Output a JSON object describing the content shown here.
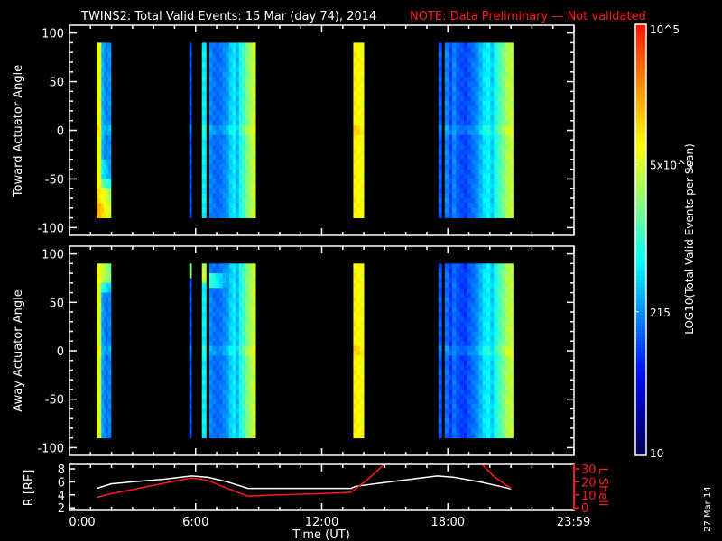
{
  "title": {
    "main": "TWINS2: Total Valid Events: 15 Mar (day  74), 2014",
    "note": "NOTE: Data Preliminary — Not validated",
    "note_color": "#ff1a1a"
  },
  "stamp": "27 Mar 14",
  "chart_data": {
    "type": "heatmap",
    "x_label": "Time (UT)",
    "x_range_hours": [
      0,
      24
    ],
    "x_tick_labels": [
      {
        "h": 0,
        "label": "0:00"
      },
      {
        "h": 6,
        "label": "6:00"
      },
      {
        "h": 12,
        "label": "12:00"
      },
      {
        "h": 18,
        "label": "18:00"
      },
      {
        "h": 23.98,
        "label": "23:59"
      }
    ],
    "colorbar": {
      "label": "LOG10(Total Valid Events per Scan)",
      "log_range": [
        1,
        5
      ],
      "tick_labels": [
        {
          "v": 5,
          "label": "10^5"
        },
        {
          "v": 3.699,
          "label": "5x10^3"
        },
        {
          "v": 2.332,
          "label": "215"
        },
        {
          "v": 1,
          "label": "10"
        }
      ]
    },
    "panels": [
      {
        "id": "toward",
        "ylabel": "Toward Actuator Angle",
        "y_range": [
          -108,
          108
        ],
        "y_tick_labels": [
          {
            "v": 100,
            "label": "100"
          },
          {
            "v": 50,
            "label": "50"
          },
          {
            "v": 0,
            "label": "0"
          },
          {
            "v": -50,
            "label": "-50"
          },
          {
            "v": -100,
            "label": "-100"
          }
        ],
        "angle_range": [
          -90,
          90
        ],
        "bands": [
          {
            "t0": 1.29,
            "t1": 1.97,
            "cols": [
              3.85,
              3.75,
              2.5,
              2.35,
              2.3,
              2.35
            ],
            "overrides": [
              {
                "a0": -50,
                "a1": -30,
                "v": 3.0
              },
              {
                "a0": -60,
                "a1": -50,
                "v": 3.5
              },
              {
                "a0": -75,
                "a1": -60,
                "v": 4.1
              },
              {
                "a0": -90,
                "a1": -75,
                "v": 4.3
              }
            ]
          },
          {
            "t0": 5.7,
            "t1": 5.8,
            "cols": [
              2.05
            ]
          },
          {
            "t0": 6.3,
            "t1": 6.5,
            "cols": [
              2.75
            ]
          },
          {
            "t0": 6.65,
            "t1": 8.85,
            "cols": [
              2.3,
              2.2,
              2.15,
              2.2,
              2.3,
              2.4,
              2.6,
              2.75,
              2.5,
              2.9,
              3.1,
              3.3,
              3.5,
              3.65
            ]
          },
          {
            "t0": 13.5,
            "t1": 14.0,
            "cols": [
              3.95,
              3.9,
              3.85
            ]
          },
          {
            "t0": 17.55,
            "t1": 17.7,
            "cols": [
              2.1
            ]
          },
          {
            "t0": 17.85,
            "t1": 21.1,
            "cols": [
              2.3,
              2.0,
              2.3,
              2.1,
              2.05,
              2.0,
              2.1,
              2.2,
              2.3,
              2.5,
              2.7,
              2.8,
              2.6,
              2.9,
              3.1,
              3.3,
              3.5,
              3.6
            ]
          }
        ]
      },
      {
        "id": "away",
        "ylabel": "Away Actuator Angle",
        "y_range": [
          -108,
          108
        ],
        "y_tick_labels": [
          {
            "v": 100,
            "label": "100"
          },
          {
            "v": 50,
            "label": "50"
          },
          {
            "v": 0,
            "label": "0"
          },
          {
            "v": -50,
            "label": "-50"
          },
          {
            "v": -100,
            "label": "-100"
          }
        ],
        "angle_range": [
          -90,
          90
        ],
        "bands": [
          {
            "t0": 1.29,
            "t1": 1.97,
            "cols": [
              3.8,
              3.6,
              2.4,
              2.3,
              2.2,
              2.3
            ],
            "overrides": [
              {
                "a0": 70,
                "a1": 90,
                "v": 3.9
              },
              {
                "a0": 60,
                "a1": 70,
                "v": 3.2
              }
            ]
          },
          {
            "t0": 5.7,
            "t1": 5.8,
            "cols": [
              2.05
            ],
            "overrides": [
              {
                "a0": 75,
                "a1": 90,
                "v": 3.4
              }
            ]
          },
          {
            "t0": 6.3,
            "t1": 6.5,
            "cols": [
              2.75
            ],
            "overrides": [
              {
                "a0": 70,
                "a1": 90,
                "v": 3.6
              }
            ]
          },
          {
            "t0": 6.65,
            "t1": 8.85,
            "cols": [
              2.3,
              2.2,
              2.15,
              2.2,
              2.3,
              2.4,
              2.6,
              2.75,
              2.5,
              2.9,
              3.1,
              3.3,
              3.5,
              3.65
            ],
            "overrides": [
              {
                "a0": 65,
                "a1": 80,
                "v": 3.0
              }
            ]
          },
          {
            "t0": 13.5,
            "t1": 14.0,
            "cols": [
              3.95,
              3.9,
              3.85
            ]
          },
          {
            "t0": 17.55,
            "t1": 17.7,
            "cols": [
              2.1
            ]
          },
          {
            "t0": 17.85,
            "t1": 21.1,
            "cols": [
              2.2,
              1.95,
              2.2,
              2.05,
              2.0,
              1.95,
              2.1,
              2.2,
              2.3,
              2.5,
              2.7,
              2.8,
              2.6,
              2.9,
              3.1,
              3.3,
              3.5,
              3.6
            ]
          }
        ]
      }
    ],
    "ephemeris": {
      "left_label": "R [RE]",
      "left_range": [
        1.6,
        8.7
      ],
      "left_tick_labels": [
        {
          "v": 8,
          "label": "8"
        },
        {
          "v": 6,
          "label": "6"
        },
        {
          "v": 4,
          "label": "4"
        },
        {
          "v": 2,
          "label": "2"
        }
      ],
      "right_label": "L Shell",
      "right_range": [
        -2,
        33.5
      ],
      "right_tick_labels": [
        {
          "v": 30,
          "label": "30"
        },
        {
          "v": 20,
          "label": "20"
        },
        {
          "v": 10,
          "label": "10"
        },
        {
          "v": 0,
          "label": "0"
        }
      ],
      "series": [
        {
          "name": "R",
          "axis": "left",
          "color": "#ffffff",
          "points": [
            [
              1.3,
              5.0
            ],
            [
              1.5,
              5.2
            ],
            [
              2.0,
              5.7
            ],
            [
              3.0,
              6.0
            ],
            [
              4.5,
              6.4
            ],
            [
              5.8,
              6.9
            ],
            [
              6.6,
              6.7
            ],
            [
              7.5,
              6.0
            ],
            [
              8.5,
              5.0
            ],
            [
              10,
              5.0
            ],
            [
              12,
              5.0
            ],
            [
              13.4,
              5.0
            ],
            [
              13.6,
              5.3
            ],
            [
              15,
              5.9
            ],
            [
              16.5,
              6.5
            ],
            [
              17.5,
              6.9
            ],
            [
              18.3,
              6.7
            ],
            [
              19.5,
              6.0
            ],
            [
              20.5,
              5.3
            ],
            [
              21.0,
              4.9
            ]
          ]
        },
        {
          "name": "L Shell",
          "axis": "right",
          "color": "#ff1a1a",
          "points": [
            [
              1.3,
              8
            ],
            [
              2.0,
              11
            ],
            [
              3.0,
              14
            ],
            [
              4.5,
              19
            ],
            [
              5.8,
              23
            ],
            [
              6.6,
              21
            ],
            [
              7.5,
              15
            ],
            [
              8.5,
              9
            ],
            [
              10,
              10
            ],
            [
              12,
              11
            ],
            [
              13.4,
              12
            ],
            [
              14.2,
              22
            ],
            [
              15.0,
              34
            ]
          ]
        },
        {
          "name": "L Shell (2)",
          "axis": "right",
          "color": "#ff1a1a",
          "points": [
            [
              19.6,
              34
            ],
            [
              20.2,
              24
            ],
            [
              21.0,
              15
            ]
          ]
        }
      ]
    }
  }
}
